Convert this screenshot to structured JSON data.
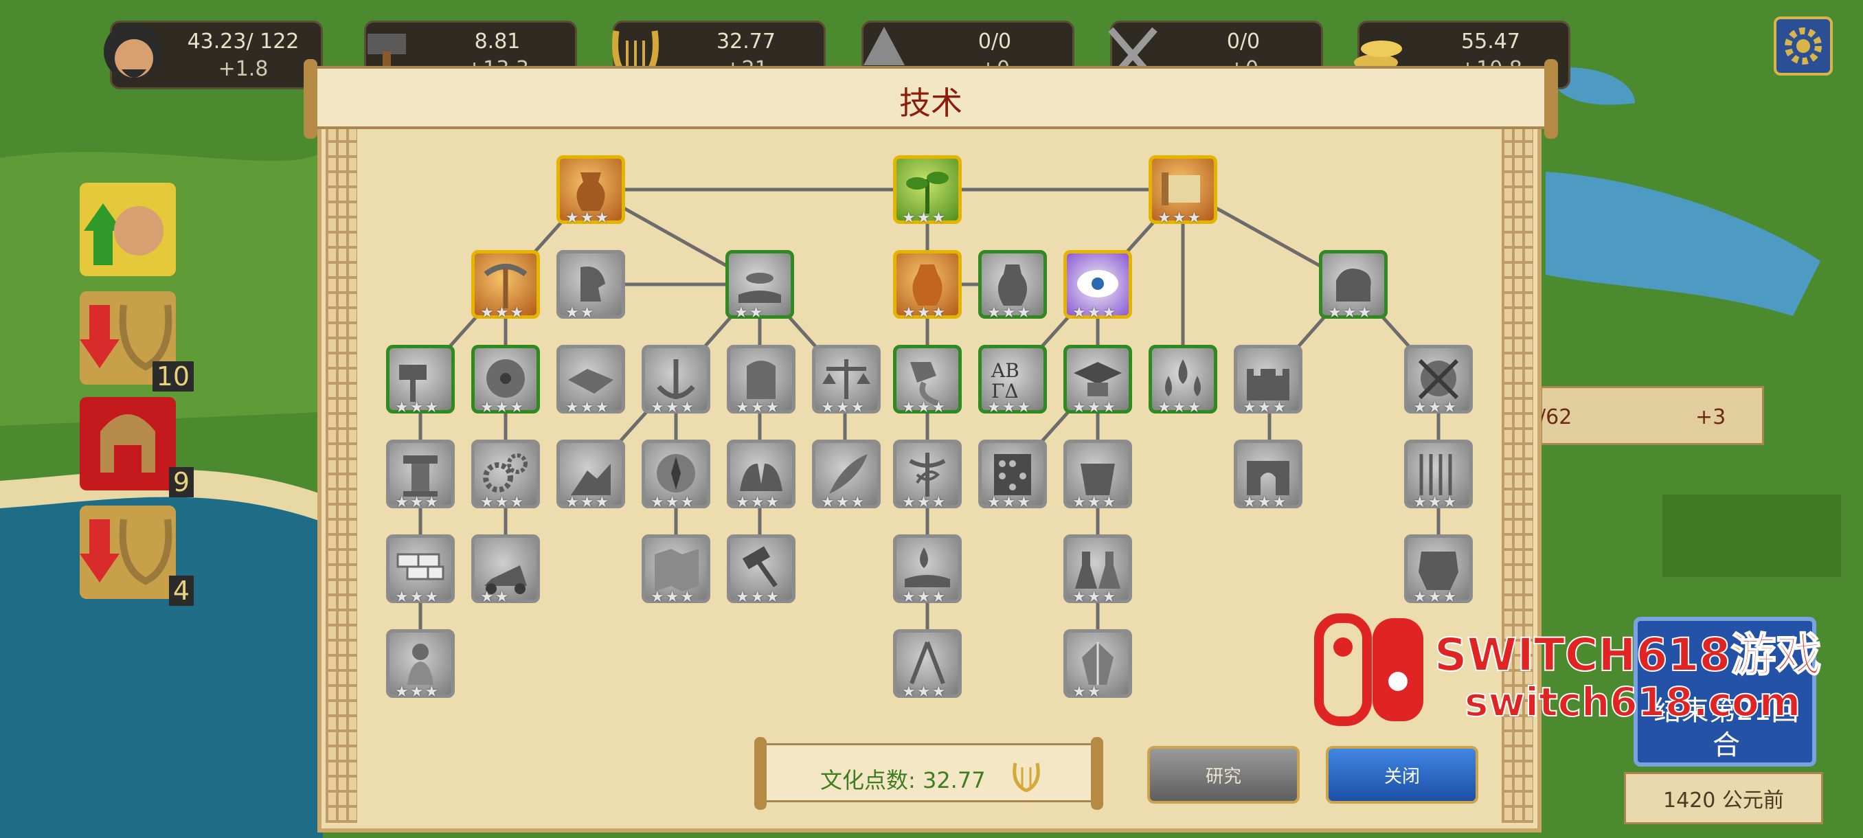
{
  "resources": [
    {
      "icon": "philosopher-face-icon",
      "value": "43.23/ 122",
      "delta": "+1.8"
    },
    {
      "icon": "hammer-icon",
      "value": "8.81",
      "delta": "+13.3"
    },
    {
      "icon": "lyre-icon",
      "value": "32.77",
      "delta": "+21"
    },
    {
      "icon": "warship-icon",
      "value": "0/0",
      "delta": "+0"
    },
    {
      "icon": "crossed-swords-icon",
      "value": "0/0",
      "delta": "+0"
    },
    {
      "icon": "gold-coins-icon",
      "value": "55.47",
      "delta": "+10.8"
    }
  ],
  "panel": {
    "title": "技术",
    "culture_label": "文化点数: 32.77",
    "research_button": "研究",
    "close_button": "关闭"
  },
  "side": {
    "badge1": "10",
    "badge2": "9",
    "badge3": "4"
  },
  "bottom_right": {
    "population": "/62",
    "population_delta": "+3",
    "end_turn": "结束第21回合",
    "year": "1420 公元前"
  },
  "watermark": {
    "line1": "SWITCH618游戏",
    "line2": "switch618.com"
  },
  "techs": [
    {
      "id": "pottery",
      "icon": "pottery-icon",
      "state": "researched",
      "stars": 2
    },
    {
      "id": "agriculture",
      "icon": "sprout-icon",
      "state": "researched",
      "stars": 1
    },
    {
      "id": "writing",
      "icon": "scroll-icon",
      "state": "researched",
      "stars": 1
    },
    {
      "id": "mining",
      "icon": "pickaxe-icon",
      "state": "researched",
      "stars": 1
    },
    {
      "id": "speech",
      "icon": "talking-face-icon",
      "state": "locked"
    },
    {
      "id": "trade",
      "icon": "coins-hand-icon",
      "state": "available"
    },
    {
      "id": "ceramics",
      "icon": "amphora-icon",
      "state": "researched",
      "stars": 1
    },
    {
      "id": "vase",
      "icon": "vase-icon",
      "state": "available"
    },
    {
      "id": "mysticism",
      "icon": "eye-cloud-icon",
      "state": "researched",
      "stars": 1
    },
    {
      "id": "strength",
      "icon": "arm-icon",
      "state": "available"
    }
  ]
}
